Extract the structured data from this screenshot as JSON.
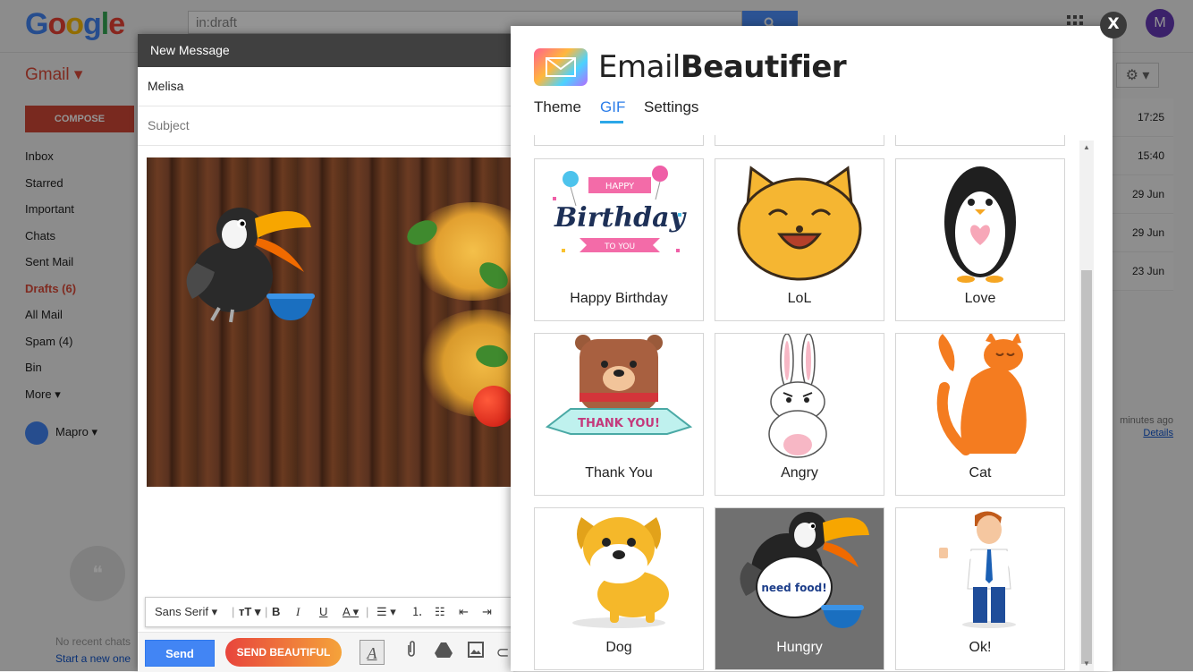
{
  "gmail": {
    "search_value": "in:draft",
    "search_icon": "search-icon",
    "account_initial": "M",
    "app_label": "Gmail ▾",
    "compose_label": "COMPOSE",
    "nav": [
      "Inbox",
      "Starred",
      "Important",
      "Chats",
      "Sent Mail",
      "Drafts (6)",
      "All Mail",
      "Spam (4)",
      "Bin",
      "More ▾"
    ],
    "active_nav": "Drafts (6)",
    "hangout_user": "Mapro ▾",
    "no_chats": "No recent chats",
    "start_new": "Start a new one",
    "dates": [
      "17:25",
      "15:40",
      "29 Jun",
      "29 Jun",
      "23 Jun"
    ],
    "last_activity": "minutes ago",
    "details_link": "Details"
  },
  "compose": {
    "header": "New Message",
    "to_value": "Melisa",
    "subject_placeholder": "Subject",
    "format": {
      "font": "Sans Serif",
      "size_icon": "text-size-icon",
      "bold": "B",
      "italic": "I",
      "underline": "U",
      "text_color": "A"
    },
    "send_label": "Send",
    "send_beautiful_label": "SEND BEAUTIFUL"
  },
  "beautifier": {
    "brand_light": "Email",
    "brand_bold": "Beautifier",
    "tabs": [
      "Theme",
      "GIF",
      "Settings"
    ],
    "active_tab": "GIF",
    "gifs": [
      {
        "label": "Happy Birthday",
        "art_text_top": "HAPPY",
        "art_text_mid": "Birthday",
        "art_text_bottom": "TO YOU"
      },
      {
        "label": "LoL"
      },
      {
        "label": "Love"
      },
      {
        "label": "Thank You",
        "art_text": "THANK YOU!"
      },
      {
        "label": "Angry"
      },
      {
        "label": "Cat"
      },
      {
        "label": "Dog"
      },
      {
        "label": "Hungry",
        "art_text": "need food!"
      },
      {
        "label": "Ok!"
      }
    ],
    "selected": "Hungry",
    "close_label": "X"
  },
  "colors": {
    "accent_blue": "#4285f4",
    "tab_active": "#2b7de9",
    "send_beautiful_start": "#e8453c",
    "send_beautiful_end": "#f5a33a",
    "selected_card": "#707070"
  }
}
